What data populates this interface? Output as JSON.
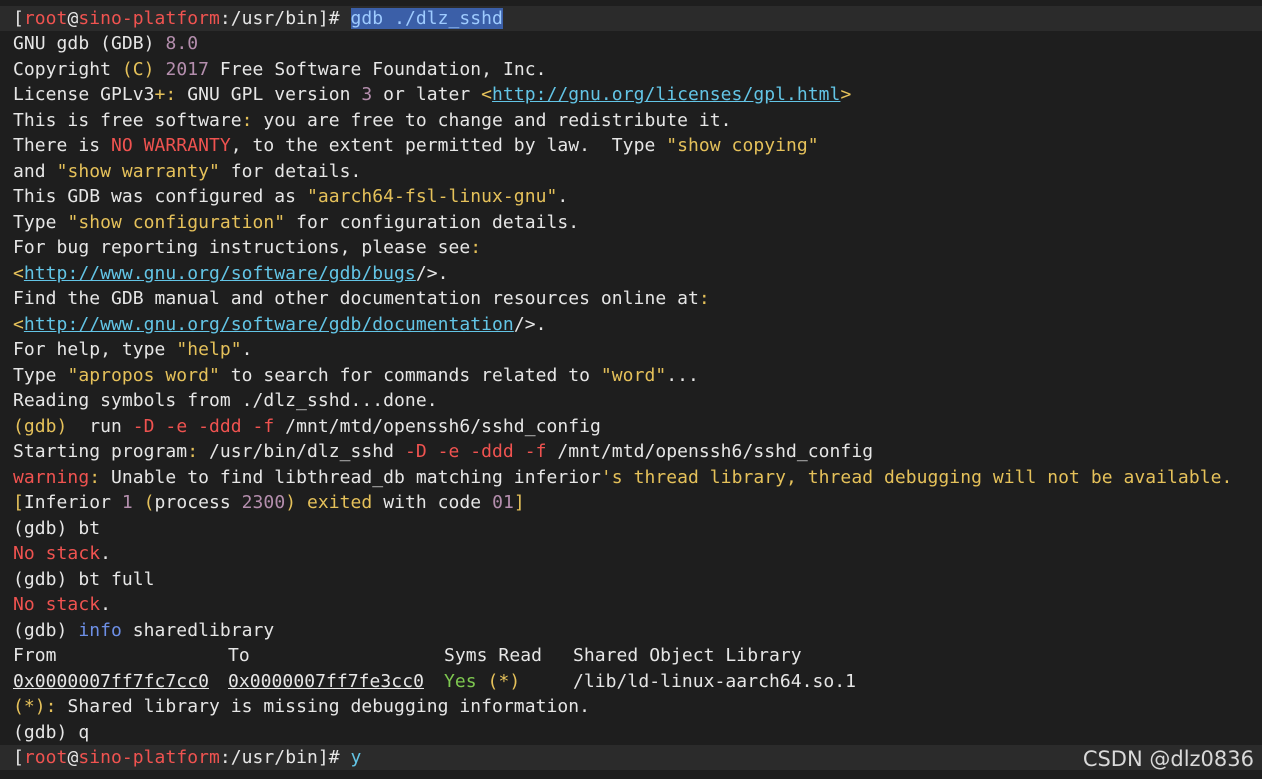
{
  "prompt": {
    "open": "[",
    "user": "root",
    "at": "@",
    "host": "sino-platform",
    "path": ":/usr/bin",
    "close": "]#",
    "first_command": "gdb ./dlz_sshd",
    "last_command": "y"
  },
  "gdb_header": {
    "l1_a": "GNU gdb ",
    "l1_b": "(GDB) ",
    "l1_c": "8.0",
    "l2_a": "Copyright ",
    "l2_b": "(C) ",
    "l2_c": "2017",
    "l2_d": " Free Software Foundation, Inc.",
    "l3_a": "License GPLv3",
    "l3_b": "+:",
    "l3_c": " GNU GPL version ",
    "l3_d": "3",
    "l3_e": " or later ",
    "l3_f": "<",
    "l3_url": "http://gnu.org/licenses/gpl.html",
    "l3_g": ">",
    "l4_a": "This is free software",
    "l4_b": ":",
    "l4_c": " you are free to change and redistribute it.",
    "l5_a": "There is ",
    "l5_b": "NO WARRANTY",
    "l5_c": ", to the extent permitted by law.  Type ",
    "l5_d": "\"show copying\"",
    "l6_a": "and ",
    "l6_b": "\"show warranty\"",
    "l6_c": " for details.",
    "l7_a": "This GDB was configured as ",
    "l7_b": "\"aarch64-fsl-linux-gnu\"",
    "l7_c": ".",
    "l8_a": "Type ",
    "l8_b": "\"show configuration\"",
    "l8_c": " for configuration details.",
    "l9_a": "For bug reporting instructions, please see",
    "l9_b": ":",
    "l10_a": "<",
    "l10_url": "http://www.gnu.org/software/gdb/bugs",
    "l10_b": "/>.",
    "l11_a": "Find the GDB manual and other documentation resources online at",
    "l11_b": ":",
    "l12_a": "<",
    "l12_url": "http://www.gnu.org/software/gdb/documentation",
    "l12_b": "/>.",
    "l13_a": "For help, type ",
    "l13_b": "\"help\"",
    "l13_c": ".",
    "l14_a": "Type ",
    "l14_b": "\"apropos word\"",
    "l14_c": " to search for commands related to ",
    "l14_d": "\"word\"",
    "l14_e": "...",
    "l15": "Reading symbols from ./dlz_sshd...done."
  },
  "session": {
    "run_a": "(gdb)",
    "run_b": "  run ",
    "run_c": "-D -e -ddd -f",
    "run_d": " /mnt/mtd/openssh6/sshd_config",
    "start_a": "Starting program",
    "start_b": ":",
    "start_c": " /usr/bin/dlz_sshd ",
    "start_d": "-D -e -ddd -f",
    "start_e": " /mnt/mtd/openssh6/sshd_config",
    "warn_a": "warning",
    "warn_b": ":",
    "warn_c": " Unable to find libthread_db matching inferior",
    "warn_d": "'s thread library, thread debugging will not be available.",
    "inf_a": "[",
    "inf_b": "Inferior ",
    "inf_c": "1",
    "inf_d": " (",
    "inf_e": "process ",
    "inf_f": "2300",
    "inf_g": ")",
    "inf_h": " exited",
    "inf_i": " with code ",
    "inf_j": "01",
    "inf_k": "]",
    "bt1_a": "(gdb)",
    "bt1_b": " bt",
    "nostack1_a": "No stack",
    "nostack1_b": ".",
    "bt2_a": "(gdb)",
    "bt2_b": " bt full",
    "nostack2_a": "No stack",
    "nostack2_b": ".",
    "info_a": "(gdb)",
    "info_b": " info",
    "info_c": " sharedlibrary",
    "hdr_from": "From",
    "hdr_to": "To",
    "hdr_syms": "Syms Read",
    "hdr_lib": "Shared Object Library",
    "row_from": "0x0000007ff7fc7cc0",
    "row_to": "0x0000007ff7fe3cc0",
    "row_syms_a": "Yes",
    "row_syms_b": " (*)",
    "row_lib": "/lib/ld-linux-aarch64.so.1",
    "missing_a": "(*):",
    "missing_b": " Shared library is missing debugging information.",
    "q_a": "(gdb)",
    "q_b": " q"
  },
  "watermark": "CSDN @dlz0836",
  "colors": {
    "background": "#1e1e1e",
    "text": "#e6e6e6",
    "yellow": "#e5c15a",
    "red": "#f05350",
    "purple": "#b48ead",
    "cyan": "#63c5e6",
    "green": "#7ec850",
    "blue": "#6d8fe6"
  }
}
